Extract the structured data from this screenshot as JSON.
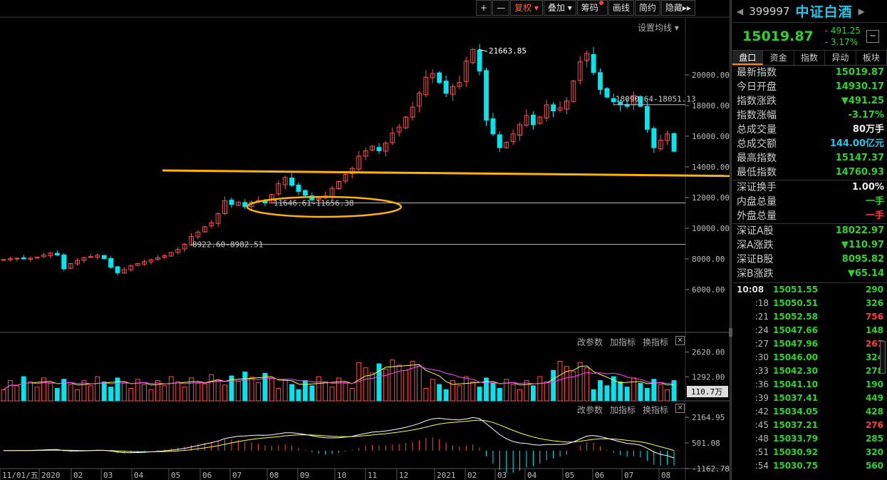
{
  "toolbar": {
    "plus": "+",
    "minus": "—",
    "fuquan": "复权",
    "diejia": "叠加",
    "chouma": "筹码",
    "huaxian": "画线",
    "jianyue": "简约",
    "yincang": "隐藏"
  },
  "ma_setting": "设置均线",
  "pane_controls": {
    "change_params": "改参数",
    "add_indicator": "加指标",
    "switch_indicator": "换指标"
  },
  "colors": {
    "up": "#ff4a4a",
    "down": "#00e5ee",
    "ma1": "#ffffff",
    "ma2": "#ffff33",
    "ma3": "#ff44ff",
    "arrow": "#ffb300",
    "green": "#2ed22e",
    "red": "#ff3b3b"
  },
  "chart_data": {
    "type": "candlestick",
    "y_ticks": [
      "20000.00",
      "18000.00",
      "16000.00",
      "14000.00",
      "12000.00",
      "10000.00",
      "8000.00",
      "6000.00"
    ],
    "annotations": {
      "high": "21663.85",
      "gap_recent": "18090.64-18051.13",
      "gap_mid": "11646.61-11656.38",
      "gap_low": "8922.60-8982.51"
    },
    "x_labels": [
      "11/01/五",
      "2020",
      "02",
      "03",
      "04",
      "05",
      "06",
      "07",
      "08",
      "09",
      "10",
      "11",
      "12",
      "2021",
      "02",
      "03",
      "04",
      "05",
      "06",
      "07",
      "08"
    ],
    "volume_ticks": [
      "2620.00",
      "1292.00"
    ],
    "volume_current": "110.7万",
    "macd_ticks": [
      "2164.95",
      "501.08",
      "-1162.78"
    ]
  },
  "quote": {
    "code": "399997",
    "name": "中证白酒",
    "price": "15019.87",
    "change": "- 491.25",
    "change_pct": "- 3.17%",
    "minimize": "−"
  },
  "tabs": [
    "盘口",
    "资金",
    "指数",
    "异动",
    "板块"
  ],
  "fields": [
    {
      "k": "最新指数",
      "v": "15019.87",
      "c": "green"
    },
    {
      "k": "今日开盘",
      "v": "14930.17",
      "c": "green"
    },
    {
      "k": "指数涨跌",
      "v": "▼491.25",
      "c": "green"
    },
    {
      "k": "指数涨幅",
      "v": "-3.17%",
      "c": "green"
    },
    {
      "k": "总成交量",
      "v": "80万手",
      "c": "white"
    },
    {
      "k": "总成交额",
      "v": "144.00亿元",
      "c": "cyan"
    },
    {
      "k": "最高指数",
      "v": "15147.37",
      "c": "green"
    },
    {
      "k": "最低指数",
      "v": "14760.93",
      "c": "green"
    }
  ],
  "fields2": [
    {
      "k": "深证换手",
      "v": "1.00%",
      "c": "white"
    },
    {
      "k": "内盘总量",
      "v": "一手",
      "c": "green"
    },
    {
      "k": "外盘总量",
      "v": "一手",
      "c": "red"
    }
  ],
  "fields3": [
    {
      "k": "深证A股",
      "v": "18022.97",
      "c": "green"
    },
    {
      "k": "深A涨跌",
      "v": "▼110.97",
      "c": "green"
    },
    {
      "k": "深证B股",
      "v": "8095.82",
      "c": "green"
    },
    {
      "k": "深B涨跌",
      "v": "▼65.14",
      "c": "green"
    }
  ],
  "ticks": [
    {
      "t": "10:08",
      "p": "15051.55",
      "q": "290",
      "c": "green"
    },
    {
      "t": ":18",
      "p": "15050.51",
      "q": "326",
      "c": "green"
    },
    {
      "t": ":21",
      "p": "15052.58",
      "q": "756",
      "c": "red"
    },
    {
      "t": ":24",
      "p": "15047.66",
      "q": "148",
      "c": "green"
    },
    {
      "t": ":27",
      "p": "15047.96",
      "q": "267",
      "c": "red"
    },
    {
      "t": ":30",
      "p": "15046.00",
      "q": "324",
      "c": "green"
    },
    {
      "t": ":33",
      "p": "15042.30",
      "q": "278",
      "c": "green"
    },
    {
      "t": ":36",
      "p": "15041.10",
      "q": "190",
      "c": "green"
    },
    {
      "t": ":39",
      "p": "15037.41",
      "q": "449",
      "c": "green"
    },
    {
      "t": ":42",
      "p": "15034.05",
      "q": "428",
      "c": "green"
    },
    {
      "t": ":45",
      "p": "15037.21",
      "q": "276",
      "c": "red"
    },
    {
      "t": ":48",
      "p": "15033.79",
      "q": "285",
      "c": "green"
    },
    {
      "t": ":51",
      "p": "15030.92",
      "q": "320",
      "c": "green"
    },
    {
      "t": ":54",
      "p": "15030.75",
      "q": "560",
      "c": "green"
    }
  ]
}
